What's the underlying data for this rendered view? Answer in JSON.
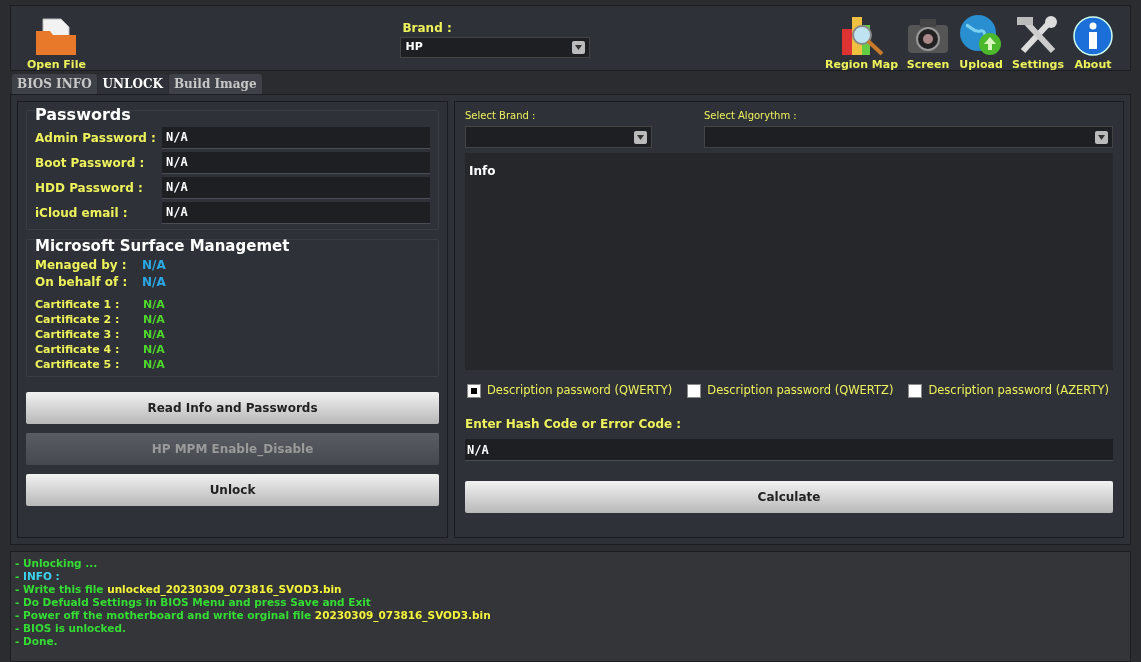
{
  "toolbar": {
    "left": [
      {
        "label": "Open File",
        "kind": "folder"
      }
    ],
    "brand": {
      "label": "Brand :",
      "value": "HP"
    },
    "right": [
      {
        "label": "Region Map",
        "kind": "map"
      },
      {
        "label": "Screen",
        "kind": "camera"
      },
      {
        "label": "Upload",
        "kind": "upload"
      },
      {
        "label": "Settings",
        "kind": "tools"
      },
      {
        "label": "About",
        "kind": "info"
      }
    ]
  },
  "tabs": [
    {
      "label": "BIOS INFO",
      "selected": false
    },
    {
      "label": "UNLOCK",
      "selected": true
    },
    {
      "label": "Build Image",
      "selected": false
    }
  ],
  "passwords": {
    "title": "Passwords",
    "fields": [
      {
        "label": "Admin Password :",
        "value": "N/A"
      },
      {
        "label": "Boot Password :",
        "value": "N/A"
      },
      {
        "label": "HDD Password :",
        "value": "N/A"
      },
      {
        "label": "iCloud email :",
        "value": "N/A"
      }
    ]
  },
  "surface": {
    "title": "Microsoft Surface Managemet",
    "owners": [
      {
        "label": "Menaged by :",
        "value": "N/A"
      },
      {
        "label": "On behalf of :",
        "value": "N/A"
      }
    ],
    "certificates": [
      {
        "label": "Cartificate 1 :",
        "value": "N/A"
      },
      {
        "label": "Cartificate 2 :",
        "value": "N/A"
      },
      {
        "label": "Cartificate 3 :",
        "value": "N/A"
      },
      {
        "label": "Cartificate 4 :",
        "value": "N/A"
      },
      {
        "label": "Cartificate 5 :",
        "value": "N/A"
      }
    ]
  },
  "left_buttons": [
    {
      "label": "Read Info and Passwords",
      "disabled": false
    },
    {
      "label": "HP MPM Enable_Disable",
      "disabled": true
    },
    {
      "label": "Unlock",
      "disabled": false
    }
  ],
  "right_panel": {
    "brand_label": "Select Brand :",
    "algorithm_label": "Select Algorythm :",
    "info_label": "Info",
    "options": [
      {
        "label": "Description password (QWERTY)",
        "checked": true
      },
      {
        "label": "Description password (QWERTZ)",
        "checked": false
      },
      {
        "label": "Description password (AZERTY)",
        "checked": false
      }
    ],
    "hash_label": "Enter Hash Code or Error Code :",
    "hash_value": "N/A",
    "calculate": "Calculate"
  },
  "log": [
    [
      {
        "text": "- Unlocking ...",
        "kind": "normal"
      }
    ],
    [
      {
        "text": "- ",
        "kind": "normal"
      },
      {
        "text": "INFO :",
        "kind": "info"
      }
    ],
    [
      {
        "text": "- Write this file ",
        "kind": "normal"
      },
      {
        "text": "unlocked_20230309_073816_SVOD3.bin",
        "kind": "file"
      }
    ],
    [
      {
        "text": "- Do Defuald Settings in BIOS Menu and press Save and Exit",
        "kind": "normal"
      }
    ],
    [
      {
        "text": "- Power off the motherboard and write orginal file ",
        "kind": "normal"
      },
      {
        "text": "20230309_073816_SVOD3.bin",
        "kind": "file"
      }
    ],
    [
      {
        "text": "- BIOS is unlocked.",
        "kind": "normal"
      }
    ],
    [
      {
        "text": "- Done.",
        "kind": "normal"
      }
    ]
  ]
}
